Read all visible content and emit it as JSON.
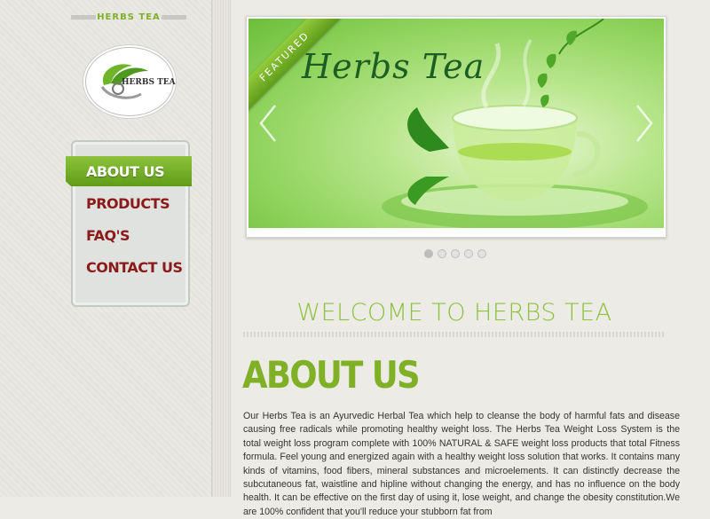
{
  "brand": {
    "name": "HERBS TEA",
    "logo_text": "HERBS TEA"
  },
  "nav": {
    "items": [
      {
        "label": "ABOUT US",
        "active": true
      },
      {
        "label": "PRODUCTS",
        "active": false
      },
      {
        "label": "FAQ'S",
        "active": false
      },
      {
        "label": "CONTACT US",
        "active": false
      }
    ]
  },
  "slider": {
    "ribbon": "FEATURED",
    "title": "Herbs Tea",
    "slide_count": 5,
    "active_slide": 1
  },
  "content": {
    "welcome": "WELCOME TO HERBS TEA",
    "heading": "ABOUT US",
    "body": "Our Herbs Tea is an Ayurvedic Herbal Tea which help to cleanse the body of harmful fats and disease causing free radicals while promoting healthy weight loss. The Herbs Tea Weight Loss System is the total weight loss program complete with 100% NATURAL & SAFE weight loss products that total Fitness formula. Feel young and energized again with a healthy weight loss solution that works. It contains many kinds of vitamins, food fibers, mineral substances and microelements. It can distinctly decrease the subcutaneous fat, waistline and hipline without changing the energy, and has no influence on the body health. It can be effective on the first day of using it, lose weight, and change the obesity constitution.We are 100% confident that you'll reduce your stubborn fat from"
  },
  "colors": {
    "accent_green": "#7fb025",
    "nav_red": "#8b1a1a",
    "slide_green": "#8fd35c"
  }
}
